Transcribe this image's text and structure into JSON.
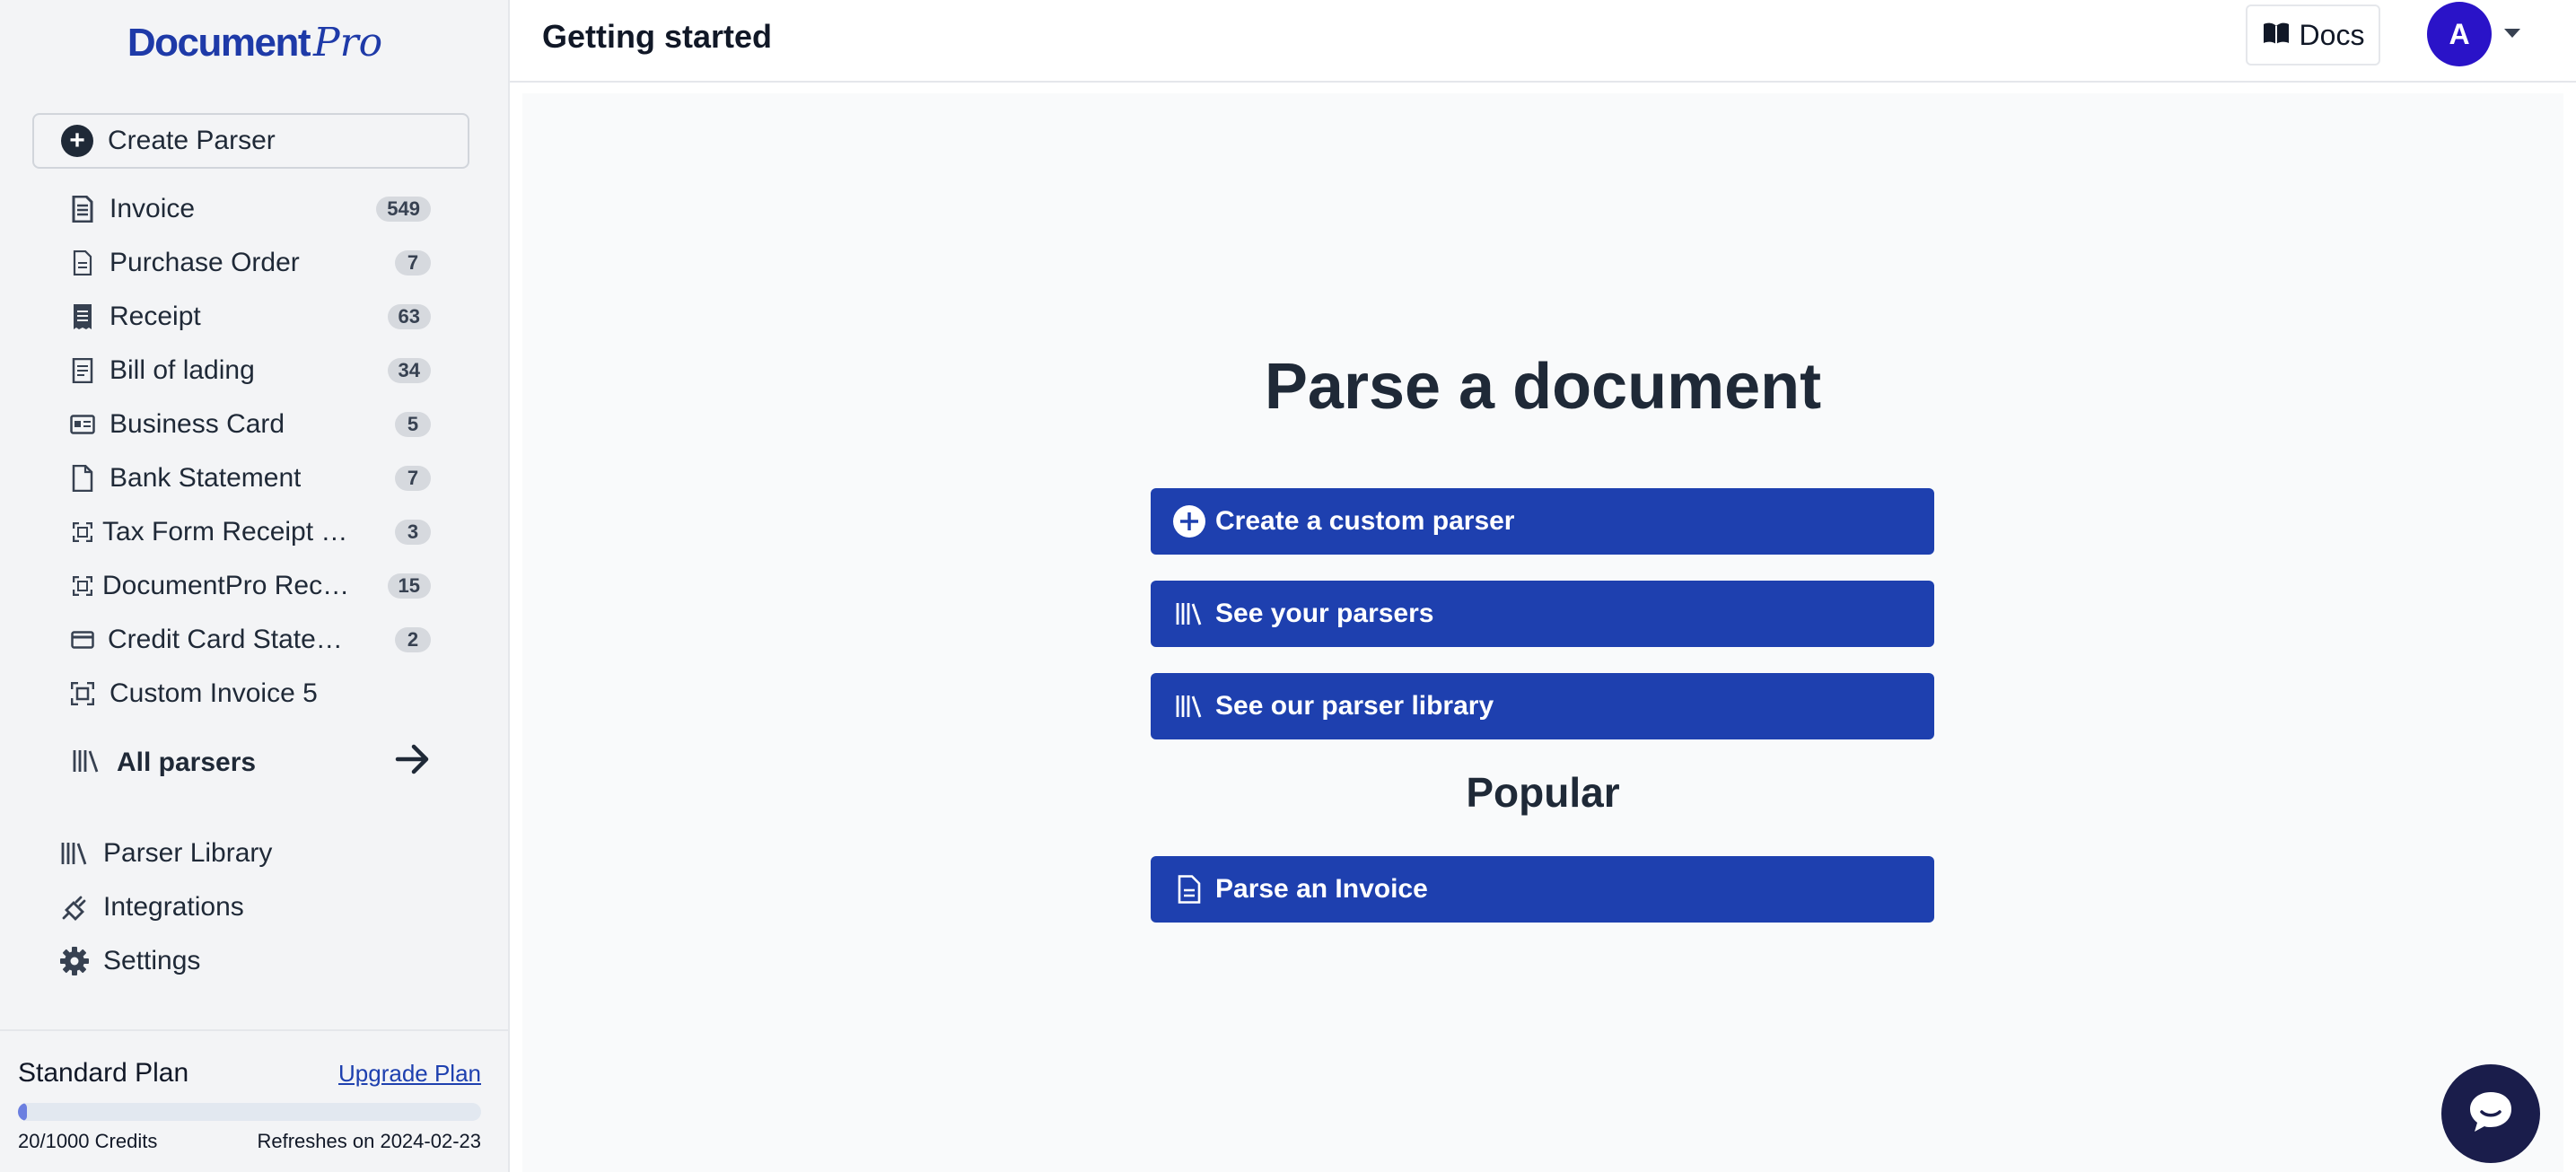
{
  "brand": {
    "name": "Document",
    "suffix": "Pro"
  },
  "sidebar": {
    "create_label": "Create Parser",
    "parsers": [
      {
        "label": "Invoice",
        "count": "549",
        "icon": "invoice-icon"
      },
      {
        "label": "Purchase Order",
        "count": "7",
        "icon": "document-icon"
      },
      {
        "label": "Receipt",
        "count": "63",
        "icon": "receipt-icon"
      },
      {
        "label": "Bill of lading",
        "count": "34",
        "icon": "document-lines-icon"
      },
      {
        "label": "Business Card",
        "count": "5",
        "icon": "business-card-icon"
      },
      {
        "label": "Bank Statement",
        "count": "7",
        "icon": "file-icon"
      },
      {
        "label": "Tax Form Receipt C...",
        "count": "3",
        "icon": "scan-icon"
      },
      {
        "label": "DocumentPro Recei...",
        "count": "15",
        "icon": "scan-icon"
      },
      {
        "label": "Credit Card Statem...",
        "count": "2",
        "icon": "credit-card-icon"
      },
      {
        "label": "Custom Invoice 5",
        "count": "",
        "icon": "scan-icon"
      }
    ],
    "all_parsers_label": "All parsers",
    "nav": [
      {
        "label": "Parser Library",
        "icon": "library-icon"
      },
      {
        "label": "Integrations",
        "icon": "plug-icon"
      },
      {
        "label": "Settings",
        "icon": "gear-icon"
      }
    ],
    "plan": {
      "name": "Standard Plan",
      "upgrade_label": "Upgrade Plan",
      "credits_label": "20/1000 Credits",
      "credits_used": 20,
      "credits_total": 1000,
      "refresh_label": "Refreshes on 2024-02-23"
    }
  },
  "header": {
    "title": "Getting started",
    "docs_label": "Docs",
    "avatar_initial": "A"
  },
  "main": {
    "title": "Parse a document",
    "actions": [
      {
        "label": "Create a custom parser",
        "icon": "plus-circle-icon"
      },
      {
        "label": "See your parsers",
        "icon": "library-icon"
      },
      {
        "label": "See our parser library",
        "icon": "library-icon"
      }
    ],
    "popular_title": "Popular",
    "popular_actions": [
      {
        "label": "Parse an Invoice",
        "icon": "document-icon"
      }
    ]
  },
  "colors": {
    "primary": "#1e40af",
    "brand": "#1e3aa8",
    "avatar": "#2a13c8",
    "chat": "#1a1d4b"
  }
}
